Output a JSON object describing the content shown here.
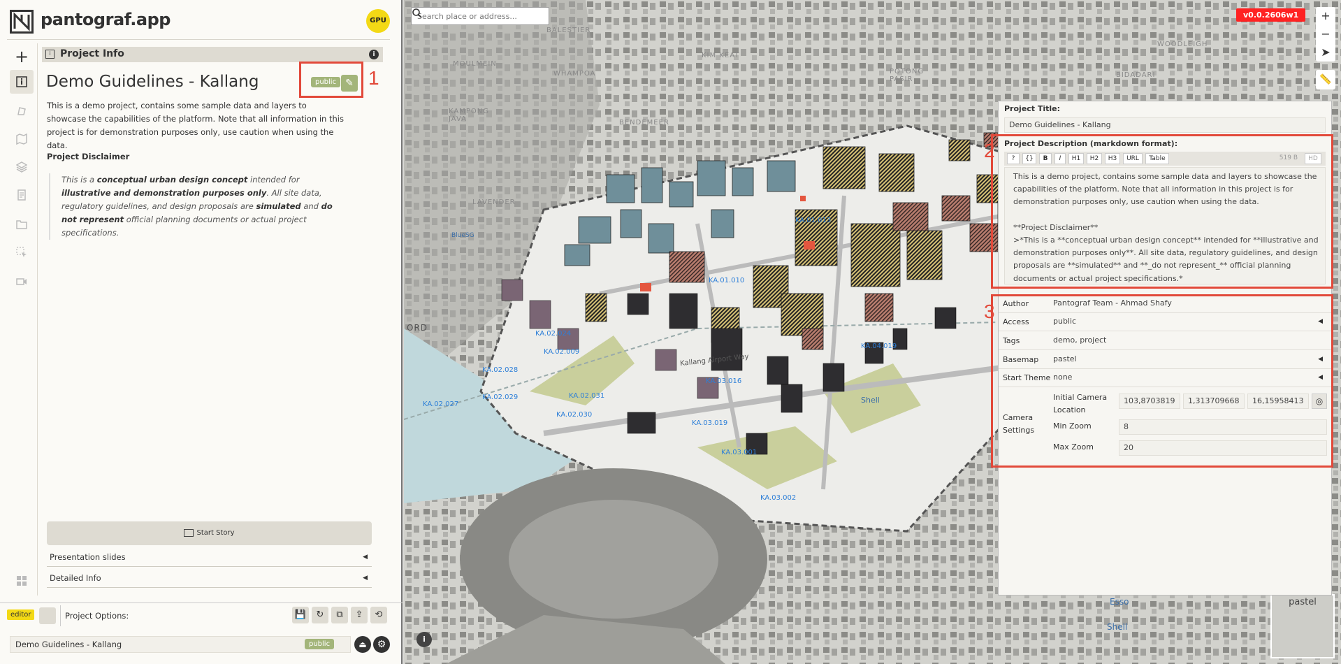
{
  "app": {
    "name": "pantograf.app",
    "gpu_label": "GPU"
  },
  "sidebar": {
    "add": "+"
  },
  "panel": {
    "header": "Project Info"
  },
  "project": {
    "title": "Demo Guidelines - Kallang",
    "access_badge": "public",
    "description": "This is a demo project, contains some sample data and layers to showcase the capabilities of the platform. Note that all information in this project is for demonstration purposes only, use caution when using the data.",
    "disclaimer_heading": "Project Disclaimer",
    "disclaimer": {
      "p1": "This is a ",
      "b1": "conceptual urban design concept",
      "p2": " intended for ",
      "b2": "illustrative and demonstration purposes only",
      "p3": ". All site data, regulatory guidelines, and design proposals are ",
      "b3": "simulated",
      "p4": " and ",
      "b4": "do not represent",
      "p5": " official planning documents or actual project specifications."
    }
  },
  "story": {
    "start_label": "Start Story"
  },
  "accordions": {
    "slides": "Presentation slides",
    "detailed": "Detailed Info"
  },
  "footer": {
    "editor_badge": "editor",
    "options_label": "Project Options:",
    "title": "Demo Guidelines - Kallang",
    "access": "public"
  },
  "annotations": {
    "one": "1",
    "two": "2",
    "three": "3"
  },
  "map": {
    "search_placeholder": "Search place or address...",
    "version": "v0.0.2606w1",
    "basemap": "pastel",
    "labels": {
      "moulmein": "MOULMEIN",
      "whampoa": "WHAMPOA",
      "bendemeer": "BENDEMEER",
      "kampong_java": "KAMPONG\nJAVA",
      "lavender": "LAVENDER",
      "kim_keat": "KIM KEAT",
      "potong_pasir": "POTONG\nPASIR",
      "bidadari": "BIDADARI",
      "woodleigh": "WOODLEIGH",
      "balestier": "BALESTIER",
      "bluesg": "BlueSG",
      "shell": "Shell",
      "esso": "Esso",
      "kallang_airport_way": "Kallang Airport Way",
      "ord": "ORD"
    },
    "zones": [
      "KA.02.027",
      "KA.02.029",
      "KA.02.030",
      "KA.02.031",
      "KA.03.019",
      "KA.03.001",
      "KA.03.002",
      "KA.01.010",
      "KA.04.019",
      "KA.01.013",
      "KA.02.028",
      "KA.02.009",
      "KA.03.016",
      "KA.02.024"
    ]
  },
  "edit": {
    "title_label": "Project Title:",
    "title_value": "Demo Guidelines - Kallang",
    "desc_label": "Project Description (markdown format):",
    "toolbar": [
      "?",
      "{}",
      "B",
      "I",
      "H1",
      "H2",
      "H3",
      "URL",
      "Table"
    ],
    "char_count": "519 B",
    "hd": "HD",
    "desc_value": "This is a demo project, contains some sample data and layers to showcase the capabilities of the platform. Note that all information in this project is for demonstration purposes only, use caution when using the data.\n\n**Project Disclaimer**\n>*This is a **conceptual urban design concept** intended for **illustrative and demonstration purposes only**. All site data, regulatory guidelines, and design proposals are **simulated** and **_do not represent_** official planning documents or actual project specifications.*",
    "author_label": "Author",
    "author_value": "Pantograf Team - Ahmad Shafy",
    "access_label": "Access",
    "access_value": "public",
    "tags_label": "Tags",
    "tags_value": "demo, project",
    "basemap_label": "Basemap",
    "basemap_value": "pastel",
    "theme_label": "Start Theme",
    "theme_value": "none",
    "camera_label": "Camera\nSettings",
    "init_cam_label": "Initial Camera\nLocation",
    "cam_lon": "103,8703819",
    "cam_lat": "1,313709668",
    "cam_zoom": "16,15958413",
    "min_zoom_label": "Min Zoom",
    "min_zoom": "8",
    "max_zoom_label": "Max Zoom",
    "max_zoom": "20"
  },
  "colors": {
    "accent_green": "#a3b57a",
    "highlight_red": "#e2493a",
    "gpu_yellow": "#f3d915",
    "version_red": "#f22222",
    "zone_blue": "#2d7fd8"
  }
}
